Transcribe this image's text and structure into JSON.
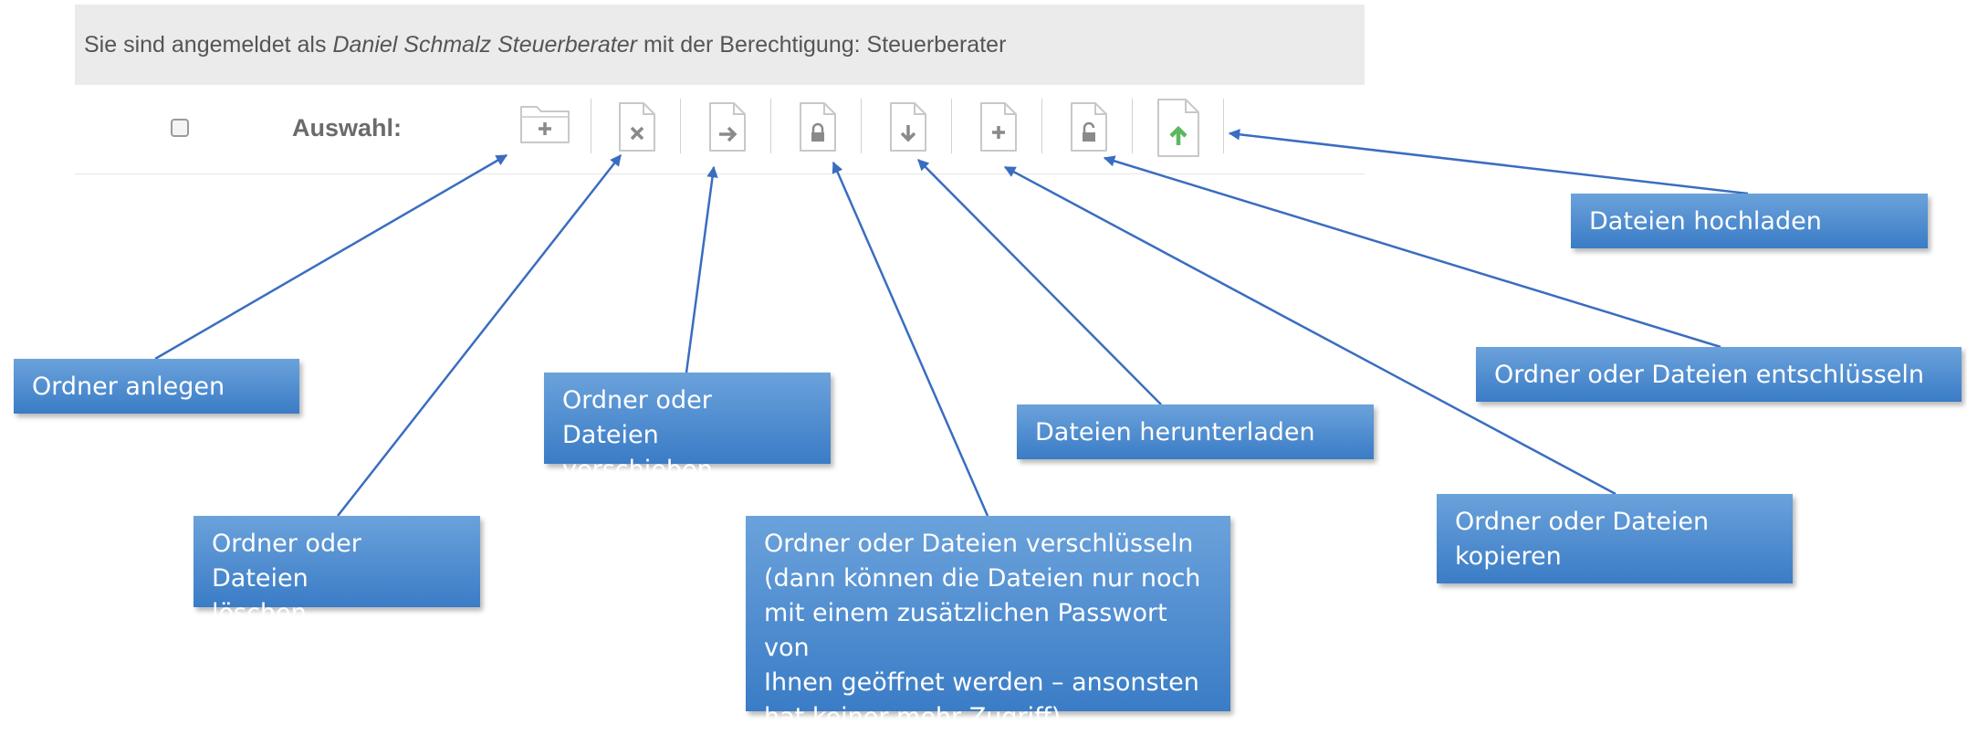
{
  "login_bar": {
    "prefix": "Sie sind angemeldet als",
    "user": "Daniel Schmalz Steuerberater",
    "suffix": "mit der Berechtigung: Steuerberater"
  },
  "toolbar": {
    "selection_label": "Auswahl:",
    "buttons": [
      {
        "icon": "folder-plus-icon"
      },
      {
        "icon": "file-delete-icon"
      },
      {
        "icon": "file-move-icon"
      },
      {
        "icon": "file-lock-icon"
      },
      {
        "icon": "file-download-icon"
      },
      {
        "icon": "file-copy-icon"
      },
      {
        "icon": "file-unlock-icon"
      },
      {
        "icon": "file-upload-icon",
        "accent": "#5cb85c"
      }
    ]
  },
  "callouts": {
    "ordner_anlegen": "Ordner anlegen",
    "loeschen": [
      "Ordner oder Dateien",
      "löschen"
    ],
    "verschieben": [
      "Ordner oder Dateien",
      "verschieben"
    ],
    "verschluesseln": [
      "Ordner oder Dateien verschlüsseln",
      "(dann können die Dateien nur noch",
      "mit einem zusätzlichen Passwort von",
      "Ihnen geöffnet werden – ansonsten",
      "hat keiner mehr Zugriff)"
    ],
    "herunterladen": "Dateien herunterladen",
    "kopieren": [
      "Ordner oder Dateien",
      "kopieren"
    ],
    "entschluesseln": "Ordner oder Dateien entschlüsseln",
    "hochladen": "Dateien hochladen"
  },
  "colors": {
    "callout_fill": "#4a8bd0",
    "arrow": "#3a6dc0",
    "upload_accent": "#5cb85c"
  }
}
